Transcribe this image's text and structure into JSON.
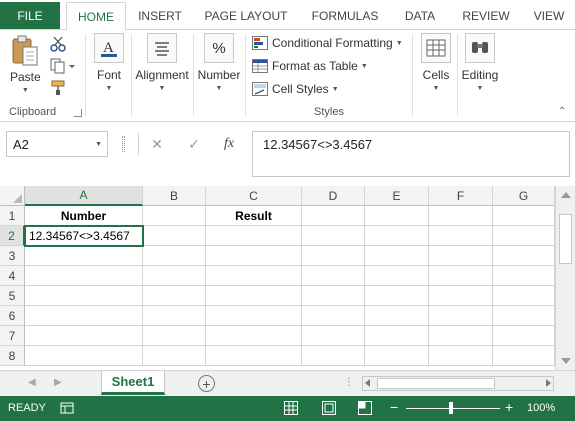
{
  "tabs": {
    "file": "FILE",
    "items": [
      "HOME",
      "INSERT",
      "PAGE LAYOUT",
      "FORMULAS",
      "DATA",
      "REVIEW",
      "VIEW"
    ],
    "active": "HOME"
  },
  "ribbon": {
    "clipboard": {
      "paste_label": "Paste",
      "group_label": "Clipboard"
    },
    "font_label": "Font",
    "alignment_label": "Alignment",
    "number_label": "Number",
    "styles": {
      "conditional_formatting": "Conditional Formatting",
      "format_as_table": "Format as Table",
      "cell_styles": "Cell Styles",
      "group_label": "Styles"
    },
    "cells_label": "Cells",
    "editing_label": "Editing"
  },
  "formula_bar": {
    "name_box": "A2",
    "cancel_glyph": "✕",
    "enter_glyph": "✓",
    "fx_glyph": "fx",
    "formula": "12.34567<>3.4567"
  },
  "grid": {
    "columns": [
      "A",
      "B",
      "C",
      "D",
      "E",
      "F",
      "G"
    ],
    "rows": [
      "1",
      "2",
      "3",
      "4",
      "5",
      "6",
      "7",
      "8"
    ],
    "cells": {
      "A1": "Number",
      "C1": "Result",
      "A2": "12.34567<>3.4567"
    },
    "active_cell": "A2"
  },
  "sheets": {
    "tabs": [
      "Sheet1"
    ],
    "active": "Sheet1",
    "add_glyph": "+",
    "dots": "⋮"
  },
  "status": {
    "ready": "READY",
    "zoom": "100%",
    "zoom_minus": "−",
    "zoom_plus": "+"
  },
  "colors": {
    "accent": "#217346"
  }
}
